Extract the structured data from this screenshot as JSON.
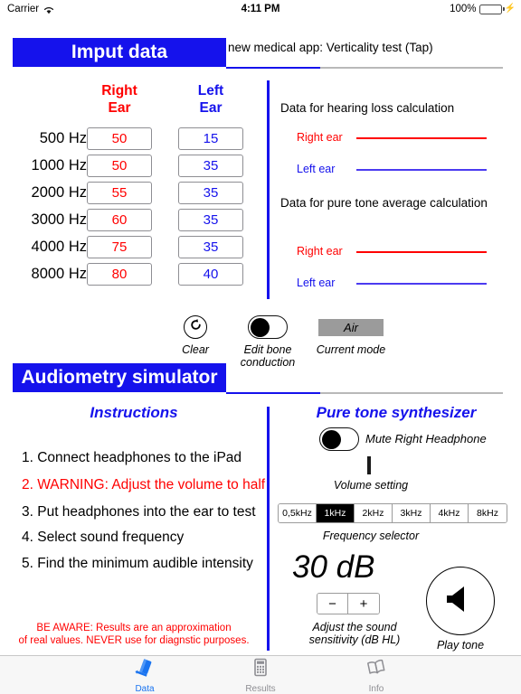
{
  "status_bar": {
    "carrier": "Carrier",
    "wifi_icon": "wifi-icon",
    "time": "4:11 PM",
    "battery_percent": "100%",
    "battery_icon": "battery-full-charging-icon"
  },
  "input_section": {
    "header_title": "Imput data",
    "note": "new medical app: Verticality test (Tap)",
    "table": {
      "col_right": "Right\nEar",
      "col_right_line1": "Right",
      "col_right_line2": "Ear",
      "col_left_line1": "Left",
      "col_left_line2": "Ear",
      "rows": [
        {
          "freq": "500 Hz",
          "right": "50",
          "left": "15"
        },
        {
          "freq": "1000 Hz",
          "right": "50",
          "left": "35"
        },
        {
          "freq": "2000 Hz",
          "right": "55",
          "left": "35"
        },
        {
          "freq": "3000 Hz",
          "right": "60",
          "left": "35"
        },
        {
          "freq": "4000 Hz",
          "right": "75",
          "left": "35"
        },
        {
          "freq": "8000 Hz",
          "right": "80",
          "left": "40"
        }
      ]
    },
    "results": {
      "hearing_loss_title": "Data for hearing loss calculation",
      "hearing_loss_right_label": "Right ear",
      "hearing_loss_right_value": "",
      "hearing_loss_left_label": "Left ear",
      "hearing_loss_left_value": "",
      "pta_title": "Data for pure tone average calculation",
      "pta_right_label": "Right ear",
      "pta_right_value": "",
      "pta_left_label": "Left ear",
      "pta_left_value": ""
    },
    "controls": {
      "clear_icon": "reset-circle-arrow-icon",
      "clear_caption": "Clear",
      "bone_toggle_state": "off",
      "bone_caption_line1": "Edit bone",
      "bone_caption_line2": "conduction",
      "mode_value": "Air",
      "mode_caption": "Current mode"
    }
  },
  "simulator_section": {
    "header_title": "Audiometry simulator",
    "instructions_title": "Instructions",
    "instructions": [
      {
        "text": "1. Connect headphones to the iPad",
        "warning": false
      },
      {
        "text": "2. WARNING: Adjust the volume to half",
        "warning": true
      },
      {
        "text": "3. Put headphones into the ear to test",
        "warning": false
      },
      {
        "text": "4. Select sound frequency",
        "warning": false
      },
      {
        "text": "5. Find the minimum audible intensity",
        "warning": false
      }
    ],
    "disclaimer_line1": "BE AWARE: Results are an approximation",
    "disclaimer_line2": "of real values. NEVER use for diagnstic purposes.",
    "synth": {
      "title": "Pure tone synthesizer",
      "mute_toggle_state": "off",
      "mute_label": "Mute Right Headphone",
      "volume_caption": "Volume setting",
      "frequencies": [
        "0,5kHz",
        "1kHz",
        "2kHz",
        "3kHz",
        "4kHz",
        "8kHz"
      ],
      "frequency_selected": "1kHz",
      "frequency_caption": "Frequency selector",
      "db_value": "30 dB",
      "minus_label": "−",
      "plus_label": "+",
      "db_caption_line1": "Adjust the sound",
      "db_caption_line2": "sensitivity  (dB HL)",
      "play_icon": "speaker-icon",
      "play_caption": "Play tone"
    }
  },
  "tab_bar": {
    "tabs": [
      {
        "label": "Data",
        "icon": "notebook-icon",
        "active": true
      },
      {
        "label": "Results",
        "icon": "calculator-icon",
        "active": false
      },
      {
        "label": "Info",
        "icon": "open-book-icon",
        "active": false
      }
    ]
  },
  "colors": {
    "brand_blue": "#1512ec",
    "right_red": "#ff0000",
    "left_blue": "#1512ec",
    "tab_active": "#1a74f0",
    "tab_inactive": "#8e8e93",
    "mode_pill_gray": "#9b9b9b"
  }
}
